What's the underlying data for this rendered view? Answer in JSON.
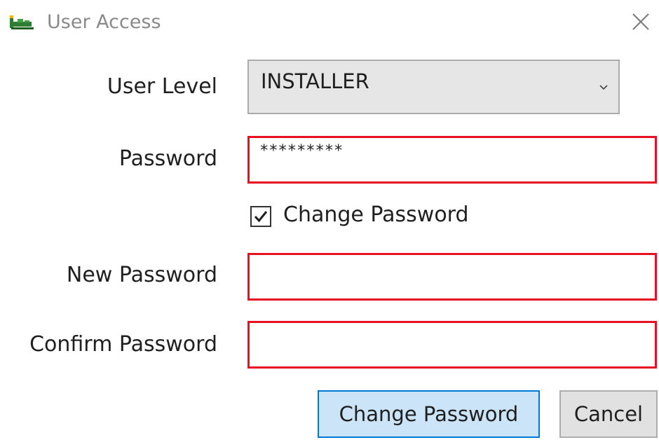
{
  "window": {
    "title": "User Access",
    "app_icon": "green-network-icon",
    "close_icon": "close-icon"
  },
  "form": {
    "user_level_label": "User Level",
    "user_level_value": "INSTALLER",
    "password_label": "Password",
    "password_value": "*********",
    "change_password_checkbox_label": "Change Password",
    "change_password_checked": true,
    "new_password_label": "New Password",
    "new_password_value": "",
    "confirm_password_label": "Confirm Password",
    "confirm_password_value": "",
    "error_border_color": "#e81123"
  },
  "buttons": {
    "change_password": "Change Password",
    "cancel": "Cancel"
  }
}
